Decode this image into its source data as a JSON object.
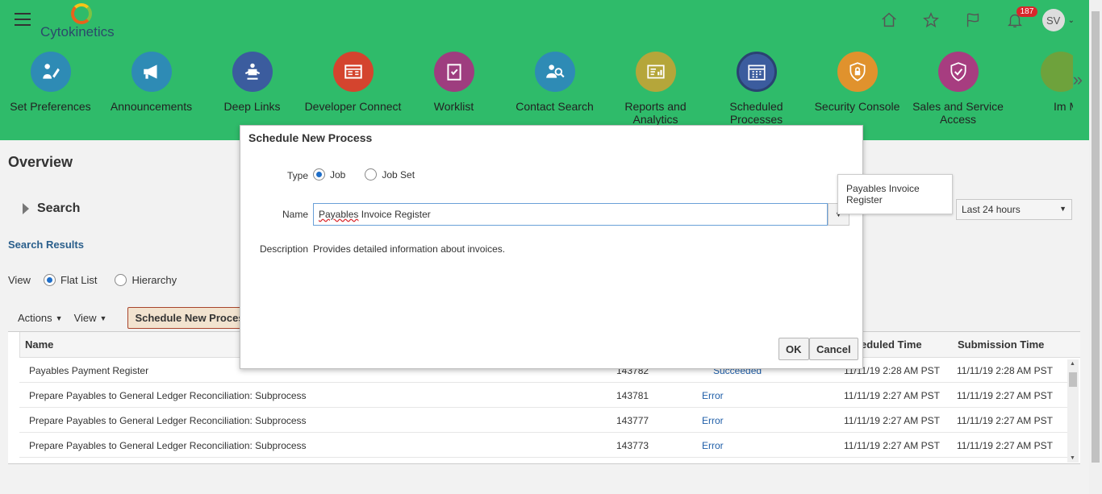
{
  "app": {
    "brand": "Cytokinetics",
    "notifications_count": "187",
    "user_initials": "SV"
  },
  "springboard": [
    {
      "label": "Set Preferences",
      "color": "#2e8bb5",
      "icon": "preferences-icon"
    },
    {
      "label": "Announcements",
      "color": "#2e8bb5",
      "icon": "megaphone-icon"
    },
    {
      "label": "Deep Links",
      "color": "#3b5c9e",
      "icon": "deep-links-icon"
    },
    {
      "label": "Developer Connect",
      "color": "#d4442e",
      "icon": "developer-icon"
    },
    {
      "label": "Worklist",
      "color": "#9e3d7f",
      "icon": "clipboard-check-icon"
    },
    {
      "label": "Contact Search",
      "color": "#2e8bb5",
      "icon": "contact-search-icon"
    },
    {
      "label": "Reports and Analytics",
      "color": "#b5a63a",
      "icon": "reports-icon"
    },
    {
      "label": "Scheduled Processes",
      "color": "#3b5c9e",
      "icon": "calendar-icon"
    },
    {
      "label": "Security Console",
      "color": "#e0922d",
      "icon": "security-lock-icon"
    },
    {
      "label": "Sales and Service Access",
      "color": "#a73d80",
      "icon": "shield-check-icon"
    },
    {
      "label": "Im Mana",
      "color": "#6ea23c",
      "icon": "truncated-tile-icon"
    }
  ],
  "page": {
    "title": "Overview",
    "search_label": "Search",
    "search_results_label": "Search Results",
    "view_label": "View",
    "view_options": [
      "Flat List",
      "Hierarchy"
    ],
    "actions_label": "Actions",
    "view_menu_label": "View",
    "schedule_button": "Schedule New Process",
    "time_filter": "Last 24 hours"
  },
  "table": {
    "headers": {
      "name": "Name",
      "scheduled": "eduled Time",
      "submission": "Submission Time"
    },
    "rows": [
      {
        "name": "Payables Payment Register",
        "id": "143782",
        "status": "Succeeded",
        "scheduled": "11/11/19 2:28 AM PST",
        "submitted": "11/11/19 2:28 AM PST"
      },
      {
        "name": "Prepare Payables to General Ledger Reconciliation: Subprocess",
        "id": "143781",
        "status": "Error",
        "scheduled": "11/11/19 2:27 AM PST",
        "submitted": "11/11/19 2:27 AM PST"
      },
      {
        "name": "Prepare Payables to General Ledger Reconciliation: Subprocess",
        "id": "143777",
        "status": "Error",
        "scheduled": "11/11/19 2:27 AM PST",
        "submitted": "11/11/19 2:27 AM PST"
      },
      {
        "name": "Prepare Payables to General Ledger Reconciliation: Subprocess",
        "id": "143773",
        "status": "Error",
        "scheduled": "11/11/19 2:27 AM PST",
        "submitted": "11/11/19 2:27 AM PST"
      }
    ]
  },
  "dialog": {
    "title": "Schedule New Process",
    "type_label": "Type",
    "type_options": [
      "Job",
      "Job Set"
    ],
    "name_label": "Name",
    "name_value_misspelled": "Payables",
    "name_value_rest": " Invoice Register",
    "description_label": "Description",
    "description_value": "Provides detailed information about invoices.",
    "ok_label": "OK",
    "cancel_label": "Cancel",
    "tooltip": "Payables Invoice Register"
  }
}
